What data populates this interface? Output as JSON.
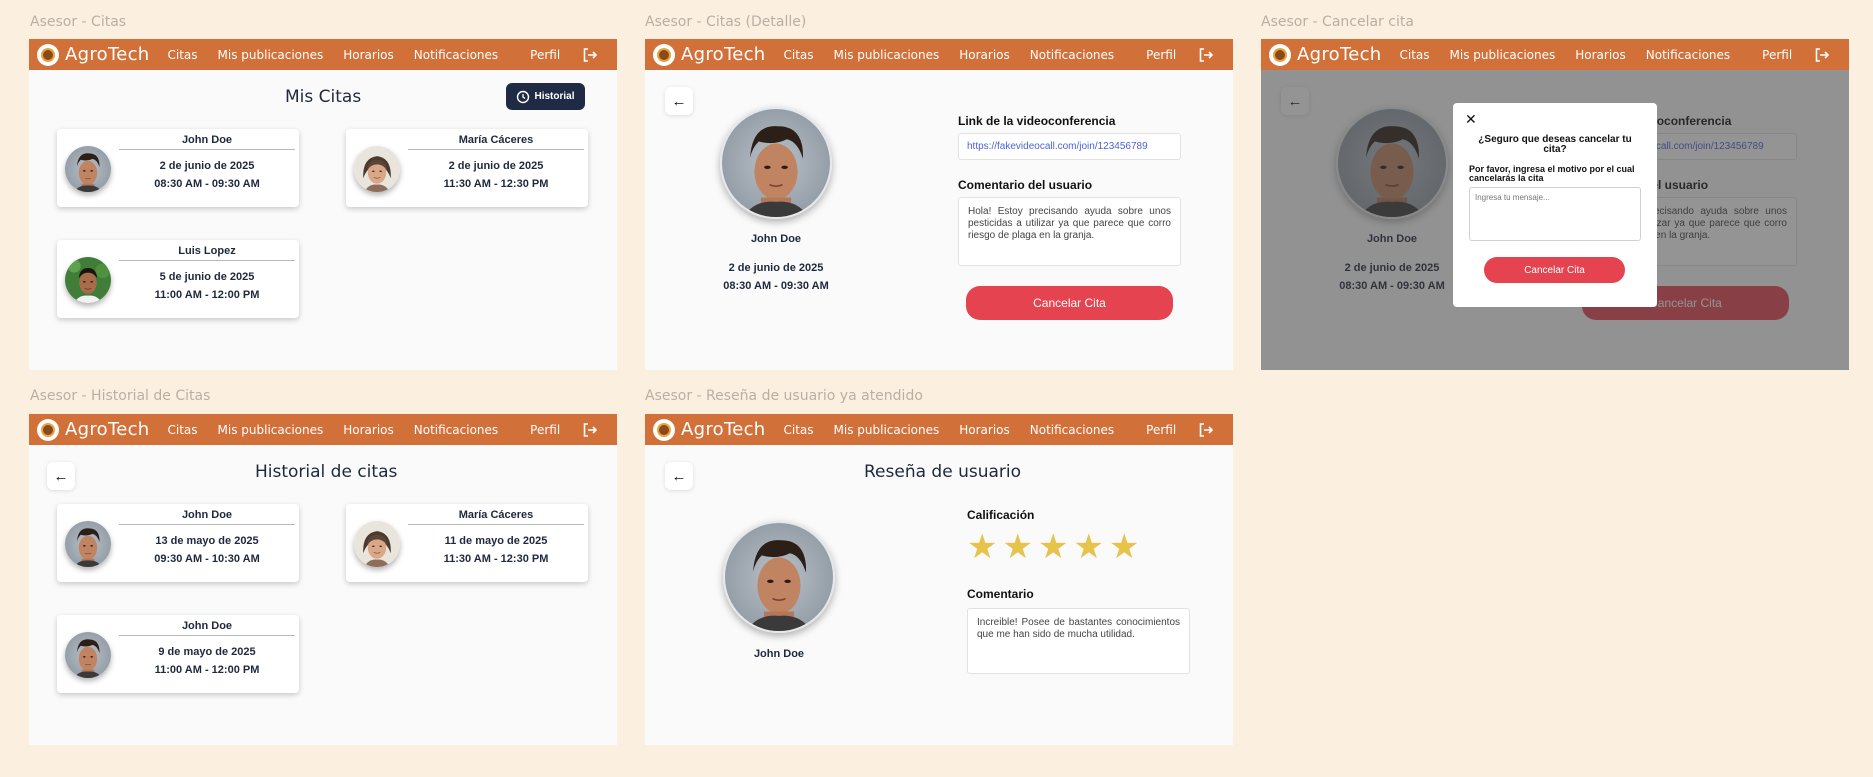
{
  "nav": {
    "brand": "AgroTech",
    "items": [
      "Citas",
      "Mis publicaciones",
      "Horarios",
      "Notificaciones"
    ],
    "perfil": "Perfil"
  },
  "frames": {
    "citas": {
      "label": "Asesor - Citas",
      "title": "Mis Citas",
      "historial_button": "Historial",
      "cards": [
        {
          "name": "John Doe",
          "date": "2 de junio de 2025",
          "time": "08:30 AM - 09:30 AM"
        },
        {
          "name": "María Cáceres",
          "date": "2 de junio de 2025",
          "time": "11:30 AM - 12:30 PM"
        },
        {
          "name": "Luis Lopez",
          "date": "5 de junio de 2025",
          "time": "11:00 AM - 12:00 PM"
        }
      ]
    },
    "detalle": {
      "label": "Asesor - Citas (Detalle)",
      "name": "John Doe",
      "date": "2 de junio de 2025",
      "time": "08:30 AM - 09:30 AM",
      "link_label": "Link de la videoconferencia",
      "link": "https://fakevideocall.com/join/123456789",
      "comment_label": "Comentario del usuario",
      "comment": "Hola! Estoy precisando ayuda sobre unos pesticidas a utilizar ya que parece que corro riesgo de plaga en la granja.",
      "cancel_button": "Cancelar Cita"
    },
    "cancelar": {
      "label": "Asesor - Cancelar cita",
      "question": "¿Seguro que deseas cancelar tu cita?",
      "reason": "Por favor, ingresa el motivo por el cual cancelarás la cita",
      "placeholder": "Ingresa tu mensaje...",
      "cancel_button": "Cancelar Cita"
    },
    "historial": {
      "label": "Asesor - Historial de Citas",
      "title": "Historial de citas",
      "cards": [
        {
          "name": "John Doe",
          "date": "13 de mayo de 2025",
          "time": "09:30 AM - 10:30 AM"
        },
        {
          "name": "María Cáceres",
          "date": "11 de mayo de 2025",
          "time": "11:30 AM - 12:30 PM"
        },
        {
          "name": "John Doe",
          "date": "9 de mayo de 2025",
          "time": "11:00 AM - 12:00 PM"
        }
      ]
    },
    "resena": {
      "label": "Asesor - Reseña de usuario ya atendido",
      "title": "Reseña de usuario",
      "name": "John Doe",
      "rating_label": "Calificación",
      "rating": 5,
      "comment_label": "Comentario",
      "comment": "Increible! Posee de bastantes conocimientos que me han sido de mucha utilidad."
    }
  },
  "colors": {
    "background": "#fbefdf",
    "nav": "#d2703a",
    "accent_red": "#e54350",
    "dark_button": "#1f2a44",
    "star": "#e6c34a"
  }
}
